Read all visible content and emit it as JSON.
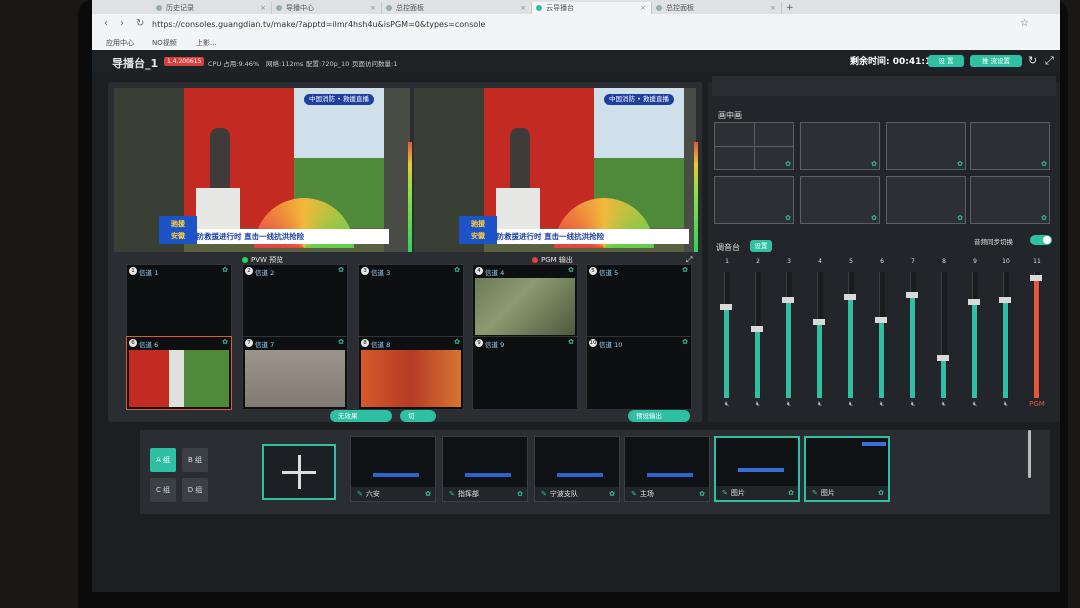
{
  "browser": {
    "tabs": [
      {
        "label": "历史记录"
      },
      {
        "label": "导播中心"
      },
      {
        "label": "总控面板"
      },
      {
        "label": "云导播台"
      },
      {
        "label": "总控面板"
      }
    ],
    "url": "https://consoles.guangdian.tv/make/?apptd=ilmr4hsh4u&isPGM=0&types=console",
    "bookmarks": [
      "应用中心",
      "NO视频",
      "上影..."
    ]
  },
  "header": {
    "title": "导播台_1",
    "version": "1.4.200615",
    "cpu": "CPU 占用:9.46%",
    "network": "网络:112ms",
    "config": "配置:720p_10",
    "visits": "页面访问数量:1",
    "remaining": "剩余时间: 00:41:13",
    "btn_settings": "设 置",
    "btn_push": "推 流设置"
  },
  "monitor": {
    "pvw_label": "PVW 预览",
    "pgm_label": "PGM 输出",
    "logo_text": "中国消防 • 救援直播",
    "badge_text_1": "驰援",
    "badge_text_2": "安徽",
    "banner_text": "消防救援进行时  直击一线抗洪抢险",
    "channels": [
      {
        "num": "1",
        "label": "信道 1"
      },
      {
        "num": "2",
        "label": "信道 2"
      },
      {
        "num": "3",
        "label": "信道 3"
      },
      {
        "num": "4",
        "label": "信道 4"
      },
      {
        "num": "5",
        "label": "信道 5"
      },
      {
        "num": "6",
        "label": "信道 6"
      },
      {
        "num": "7",
        "label": "信道 7"
      },
      {
        "num": "8",
        "label": "信道 8"
      },
      {
        "num": "9",
        "label": "信道 9"
      },
      {
        "num": "10",
        "label": "信道 10"
      }
    ],
    "btn_effect": "无效果",
    "btn_cut": "切",
    "btn_preset": "预设输出"
  },
  "layout_panel": {
    "title": "画中画"
  },
  "mixer": {
    "title": "调音台",
    "btn_settings": "设置",
    "sync_label": "音频同步切换",
    "channels": [
      {
        "num": "1",
        "level": 0.72
      },
      {
        "num": "2",
        "level": 0.55
      },
      {
        "num": "3",
        "level": 0.78
      },
      {
        "num": "4",
        "level": 0.6
      },
      {
        "num": "5",
        "level": 0.8
      },
      {
        "num": "6",
        "level": 0.62
      },
      {
        "num": "7",
        "level": 0.82
      },
      {
        "num": "8",
        "level": 0.32
      },
      {
        "num": "9",
        "level": 0.76
      },
      {
        "num": "10",
        "level": 0.78
      },
      {
        "num": "11",
        "level": 0.95
      }
    ],
    "pgm_label": "PGM"
  },
  "bottom": {
    "groups": [
      "A 组",
      "B 组",
      "C 组",
      "D 组"
    ],
    "scenes": [
      "六安",
      "指挥部",
      "宁波支队",
      "主场",
      "图片",
      "图片"
    ]
  },
  "colors": {
    "accent": "#2fbfa3",
    "alert": "#d7413d"
  }
}
